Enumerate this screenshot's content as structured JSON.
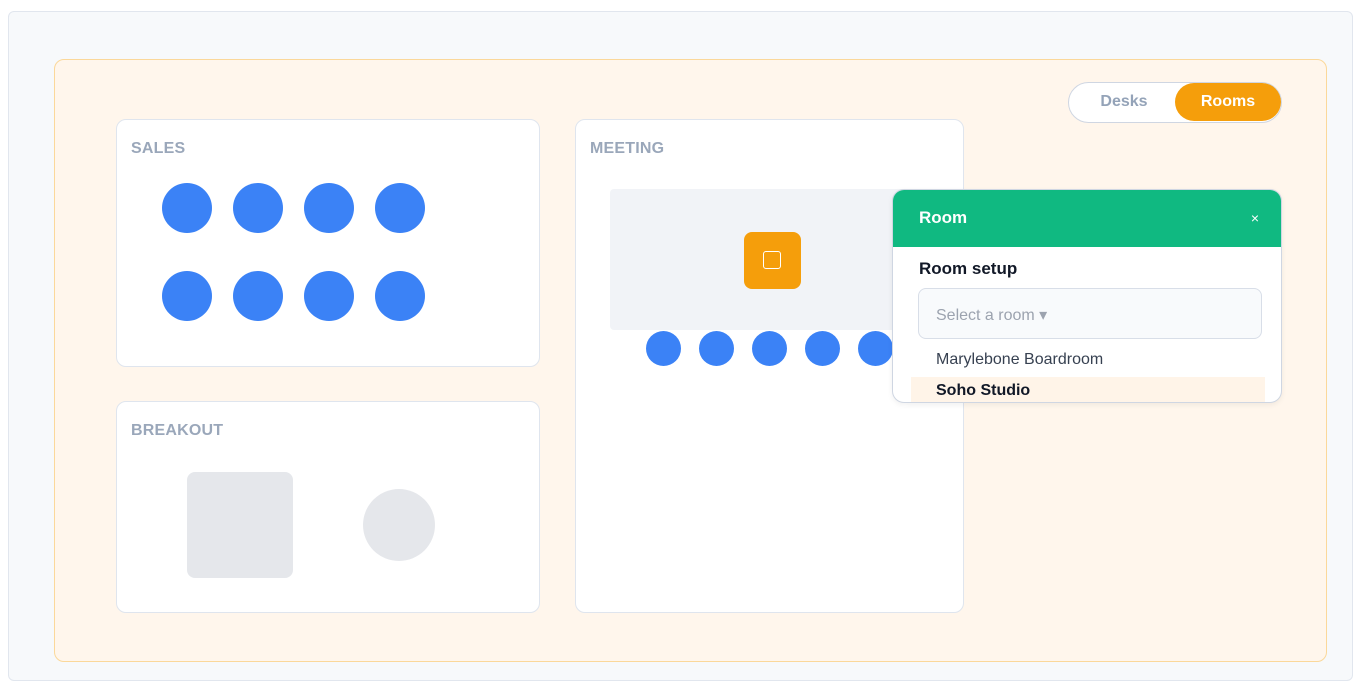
{
  "view_toggle": {
    "desks_label": "Desks",
    "rooms_label": "Rooms",
    "active": "Rooms"
  },
  "zones": {
    "sales": {
      "label": "SALES"
    },
    "breakout": {
      "label": "BREAKOUT"
    },
    "meeting": {
      "label": "MEETING"
    }
  },
  "popup": {
    "title": "Room",
    "close_label": "×",
    "setup_label": "Room setup",
    "select_placeholder": "Select a room ▾",
    "options": [
      "Marylebone Boardroom",
      "Soho Studio"
    ],
    "highlighted_option": "Soho Studio"
  },
  "colors": {
    "desk": "#3b82f6",
    "room_marker": "#f59e0b",
    "popup_header": "#10b981",
    "floor_bg": "#fff6ec",
    "toggle_active": "#f59e0b"
  }
}
